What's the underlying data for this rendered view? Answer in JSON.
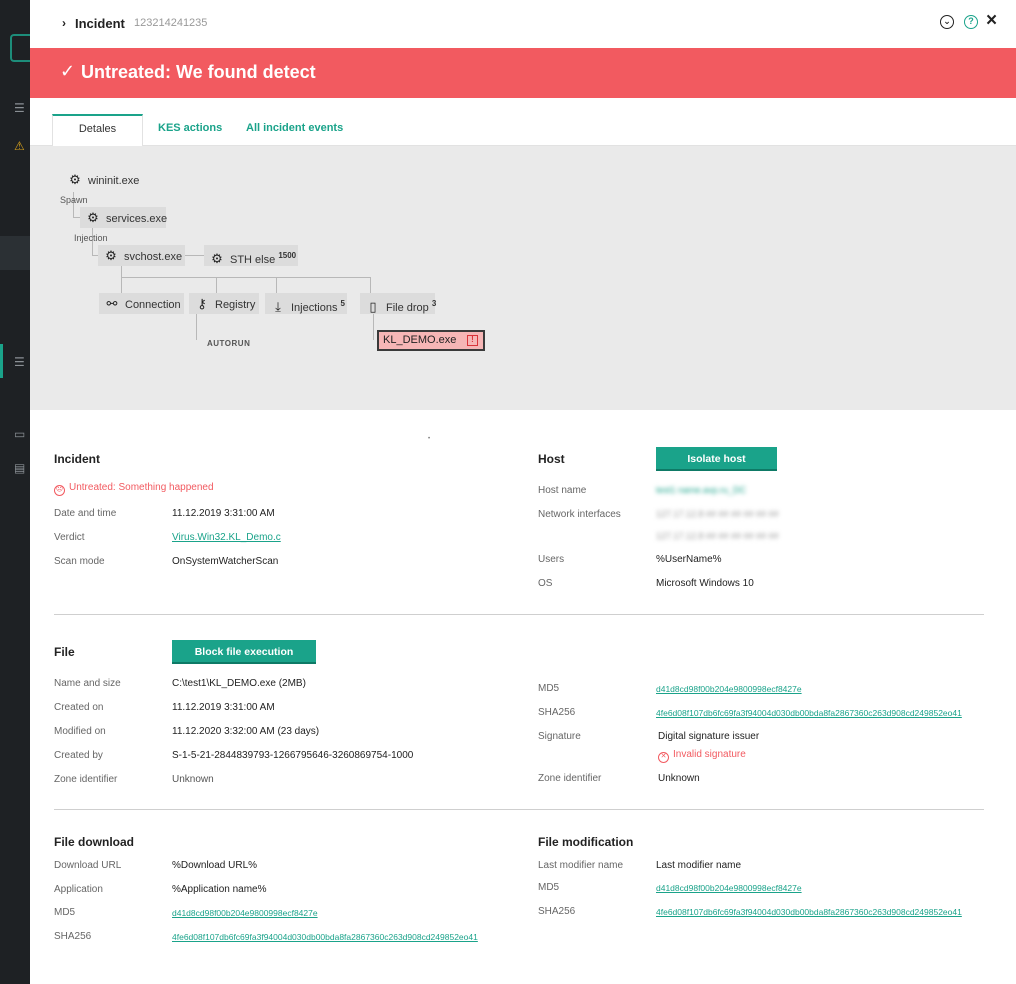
{
  "header": {
    "title": "Incident",
    "incident_id": "123214241235"
  },
  "banner": {
    "text": "Untreated: We found detect"
  },
  "tabs": [
    {
      "label": "Detales"
    },
    {
      "label": "KES actions"
    },
    {
      "label": "All incident events"
    }
  ],
  "graph": {
    "nodes": {
      "wininit": "wininit.exe",
      "services": "services.exe",
      "svchost": "svchost.exe",
      "sth_else": "STH else",
      "sth_else_count": "1500",
      "connection": "Connection",
      "registry": "Registry",
      "injections": "Injections",
      "injections_count": "5",
      "file_drop": "File drop",
      "file_drop_count": "3",
      "kl_demo": "KL_DEMO.exe"
    },
    "edge_labels": {
      "spawn": "Spawn",
      "injection": "Injection",
      "autorun": "AUTORUN"
    }
  },
  "incident": {
    "title": "Incident",
    "status": "Untreated: Something happened",
    "rows": [
      {
        "label": "Date and time",
        "value": "11.12.2019 3:31:00 AM"
      },
      {
        "label": "Verdict",
        "value": "Virus.Win32.KL_Demo.c"
      },
      {
        "label": "Scan mode",
        "value": "OnSystemWatcherScan"
      }
    ]
  },
  "host": {
    "title": "Host",
    "isolate_button": "Isolate host",
    "host_name_label": "Host name",
    "host_name_value": "test1 name.avp.ru_DC",
    "network_label": "Network interfaces",
    "network_values": [
      "127.17.12.8  ## ## ## ## ## ##",
      "127.17.12.8  ## ## ## ## ## ##"
    ],
    "users_label": "Users",
    "users_value": "%UserName%",
    "os_label": "OS",
    "os_value": "Microsoft Windows 10"
  },
  "file": {
    "title": "File",
    "block_button": "Block file execution",
    "rows": [
      {
        "label": "Name and size",
        "value": "C:\\test1\\KL_DEMO.exe (2MB)"
      },
      {
        "label": "Created on",
        "value": "11.12.2019 3:31:00 AM"
      },
      {
        "label": "Modified on",
        "value": "11.12.2020 3:32:00 AM (23 days)"
      },
      {
        "label": "Created by",
        "value": "S-1-5-21-2844839793-1266795646-3260869754-1000"
      },
      {
        "label": "Zone identifier",
        "value": "Unknown"
      }
    ],
    "md5_label": "MD5",
    "md5_value": "d41d8cd98f00b204e9800998ecf8427e",
    "sha256_label": "SHA256",
    "sha256_value": "4fe6d08f107db6fc69fa3f94004d030db00bda8fa2867360c263d908cd249852eo41",
    "signature_label": "Signature",
    "signature_value": "Digital signature issuer",
    "signature_status": "Invalid signature",
    "zone_label": "Zone identifier",
    "zone_value": "Unknown"
  },
  "file_download": {
    "title": "File download",
    "rows": [
      {
        "label": "Download URL",
        "value": "%Download URL%"
      },
      {
        "label": "Application",
        "value": "%Application name%"
      }
    ],
    "md5_label": "MD5",
    "md5_value": "d41d8cd98f00b204e9800998ecf8427e",
    "sha256_label": "SHA256",
    "sha256_value": "4fe6d08f107db6fc69fa3f94004d030db00bda8fa2867360c263d908cd249852eo41"
  },
  "file_modification": {
    "title": "File modification",
    "last_modifier_label": "Last modifier name",
    "last_modifier_value": "Last modifier name",
    "md5_label": "MD5",
    "md5_value": "d41d8cd98f00b204e9800998ecf8427e",
    "sha256_label": "SHA256",
    "sha256_value": "4fe6d08f107db6fc69fa3f94004d030db00bda8fa2867360c263d908cd249852eo41"
  },
  "colors": {
    "accent": "#1aa38a",
    "alert": "#f25a60",
    "rail": "#1e2124"
  }
}
